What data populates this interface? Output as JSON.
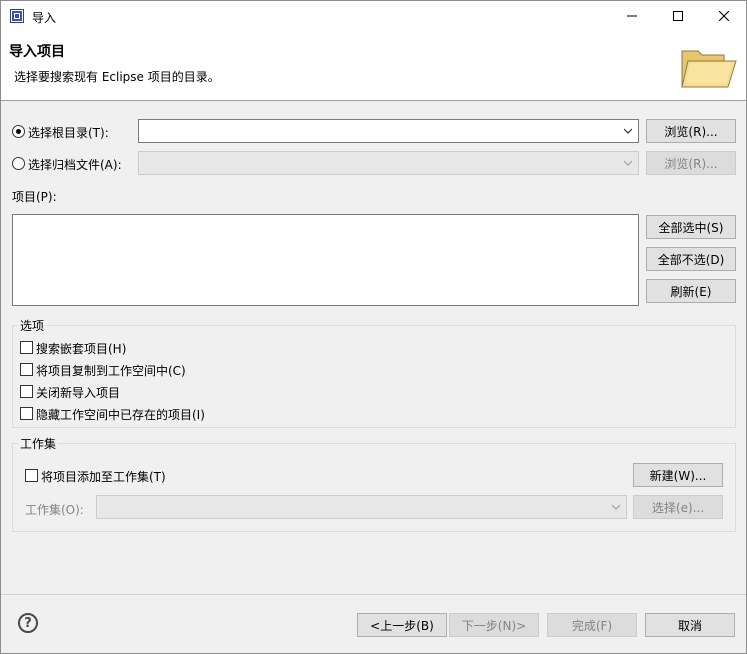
{
  "window": {
    "title": "导入"
  },
  "header": {
    "title": "导入项目",
    "description": "选择要搜索现有 Eclipse 项目的目录。"
  },
  "source": {
    "root_dir_label": "选择根目录(T):",
    "root_dir_value": "",
    "root_dir_selected": true,
    "archive_label": "选择归档文件(A):",
    "archive_value": "",
    "archive_selected": false,
    "browse_root_label": "浏览(R)...",
    "browse_archive_label": "浏览(R)..."
  },
  "projects": {
    "label": "项目(P):",
    "items": [],
    "select_all_label": "全部选中(S)",
    "deselect_all_label": "全部不选(D)",
    "refresh_label": "刷新(E)"
  },
  "options": {
    "group_label": "选项",
    "search_nested_label": "搜索嵌套项目(H)",
    "copy_to_workspace_label": "将项目复制到工作空间中(C)",
    "close_new_label": "关闭新导入项目",
    "hide_existing_label": "隐藏工作空间中已存在的项目(I)"
  },
  "working_sets": {
    "group_label": "工作集",
    "add_label": "将项目添加至工作集(T)",
    "new_label": "新建(W)...",
    "set_label": "工作集(O):",
    "set_value": "",
    "select_label": "选择(e)..."
  },
  "footer": {
    "back_label": "<上一步(B)",
    "next_label": "下一步(N)>",
    "finish_label": "完成(F)",
    "cancel_label": "取消"
  },
  "icons": {
    "app": "eclipse-app-icon",
    "folder": "open-folder-icon",
    "help": "help-icon"
  },
  "colors": {
    "window_bg": "#f0f0f0",
    "header_bg": "#ffffff",
    "button_bg": "#e1e1e1",
    "disabled_text": "#838383"
  }
}
